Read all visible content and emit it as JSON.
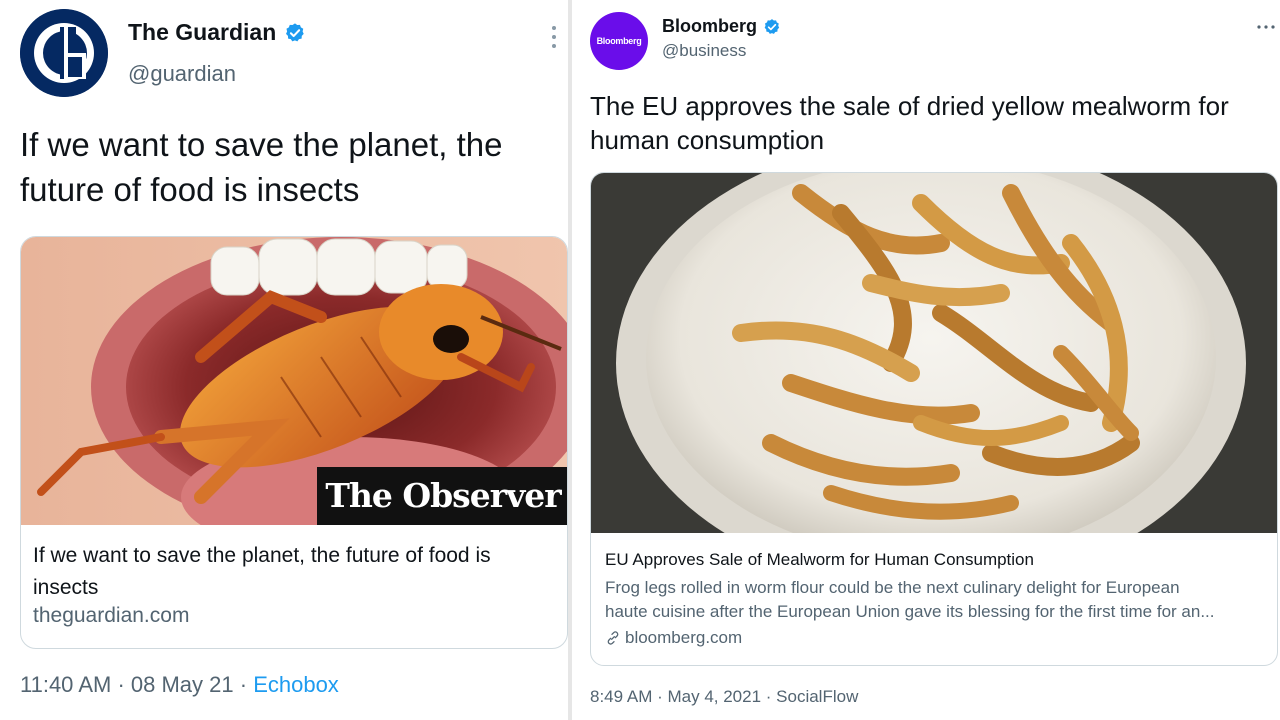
{
  "colors": {
    "verified_blue": "#1d9bf0",
    "guardian_navy": "#052962",
    "bloomberg_purple": "#6a0dea",
    "secondary_text": "#536471"
  },
  "guardian_tweet": {
    "avatar_letter": "G",
    "display_name": "The Guardian",
    "handle": "@guardian",
    "more_icon": "vertical-dots-icon",
    "verified_icon": "verified-badge-icon",
    "text": "If we want to save the planet, the future of food is insects",
    "card": {
      "image_overlay": "The Observer",
      "title": "If we want to save the planet, the future of food is insects",
      "domain": "theguardian.com"
    },
    "meta": {
      "time": "11:40 AM",
      "sep1": " · ",
      "date": "08 May 21",
      "sep2": " · ",
      "source": "Echobox"
    }
  },
  "bloomberg_tweet": {
    "avatar_text": "Bloomberg",
    "display_name": "Bloomberg",
    "handle": "@business",
    "more_icon": "horizontal-dots-icon",
    "verified_icon": "verified-badge-icon",
    "text": "The EU approves the sale of dried yellow mealworm for human consumption",
    "card": {
      "title": "EU Approves Sale of Mealworm for Human Consumption",
      "desc_line1": "Frog legs rolled in worm flour could be the next culinary delight for European",
      "desc_line2": "haute cuisine after the European Union gave its blessing for the first time for an...",
      "link_icon": "link-icon",
      "domain": "bloomberg.com"
    },
    "meta": {
      "time": "8:49 AM",
      "sep1": " · ",
      "date": "May 4, 2021",
      "sep2": " · ",
      "source": "SocialFlow"
    }
  }
}
